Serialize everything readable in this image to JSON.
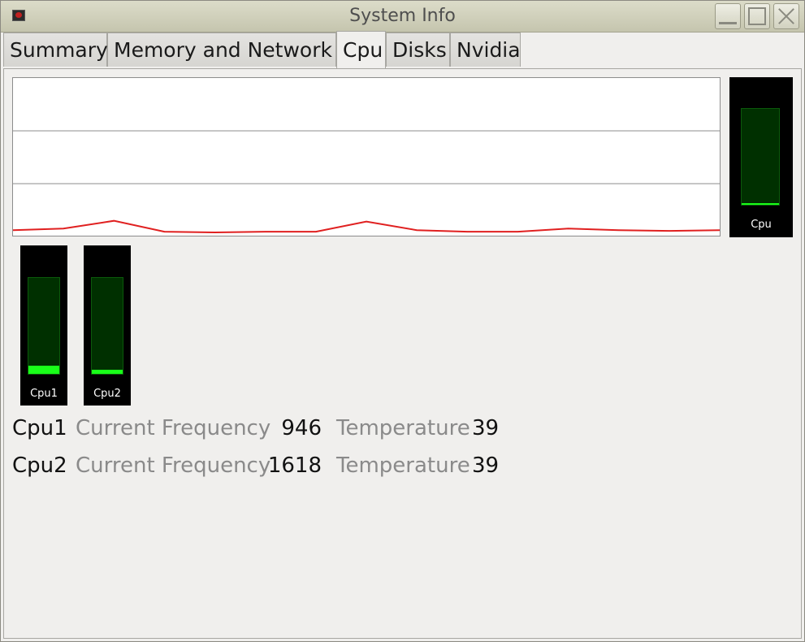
{
  "window": {
    "title": "System Info"
  },
  "tabs": [
    {
      "label": "Summary"
    },
    {
      "label": "Memory and Network"
    },
    {
      "label": "Cpu"
    },
    {
      "label": "Disks"
    },
    {
      "label": "Nvidia"
    }
  ],
  "active_tab": "Cpu",
  "colors": {
    "graph_line": "#e02020",
    "meter_fill": "#19ff19",
    "meter_trough": "#003000",
    "meter_bg": "#000000"
  },
  "cpu_history": [
    2,
    3,
    8,
    1,
    0.5,
    1,
    1,
    7.5,
    2,
    1,
    1,
    3,
    2,
    1.5,
    2
  ],
  "meters": {
    "total": {
      "label": "Cpu",
      "level": 0.02
    },
    "cpu1": {
      "label": "Cpu1",
      "level": 0.08
    },
    "cpu2": {
      "label": "Cpu2",
      "level": 0.04
    }
  },
  "cpus": [
    {
      "name": "Cpu1",
      "freq_label": "Current Frequency",
      "freq": "946",
      "temp_label": "Temperature",
      "temp": "39"
    },
    {
      "name": "Cpu2",
      "freq_label": "Current Frequency",
      "freq": "1618",
      "temp_label": "Temperature",
      "temp": "39"
    }
  ]
}
